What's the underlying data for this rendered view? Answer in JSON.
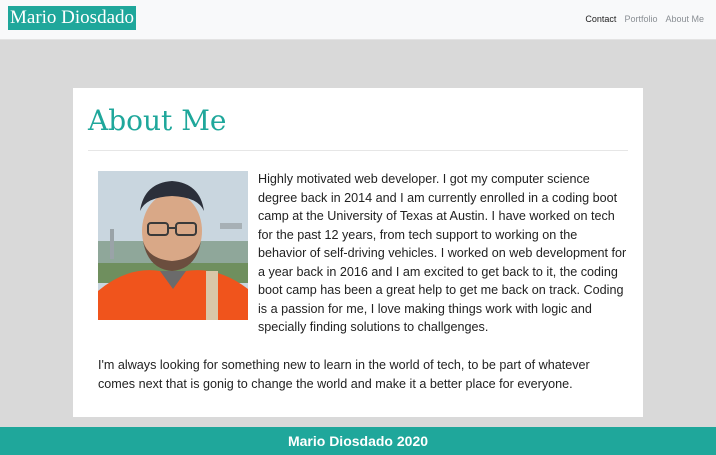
{
  "navbar": {
    "brand": "Mario Diosdado",
    "links": [
      "Contact",
      "Portfolio",
      "About Me"
    ]
  },
  "about": {
    "title": "About Me",
    "bio_paragraph_1": "Highly motivated web developer. I got my computer science degree back in 2014 and I am currently enrolled in a coding boot camp at the University of Texas at Austin. I have worked on tech for the past 12 years, from tech support to working on the behavior of self-driving vehicles. I worked on web development for a year back in 2016 and I am excited to get back to it, the coding boot camp has been a great help to get me back on track. Coding is a passion for me, I love making things work with logic and specially finding solutions to challgenges.",
    "bio_paragraph_2": "I'm always looking for something new to learn in the world of tech, to be part of whatever comes next that is gonig to change the world and make it a better place for everyone."
  },
  "footer": {
    "text": "Mario Diosdado 2020"
  },
  "colors": {
    "accent": "#1fa79b",
    "page_bg": "#d9d9d9",
    "navbar_bg": "#f8f9fa"
  }
}
